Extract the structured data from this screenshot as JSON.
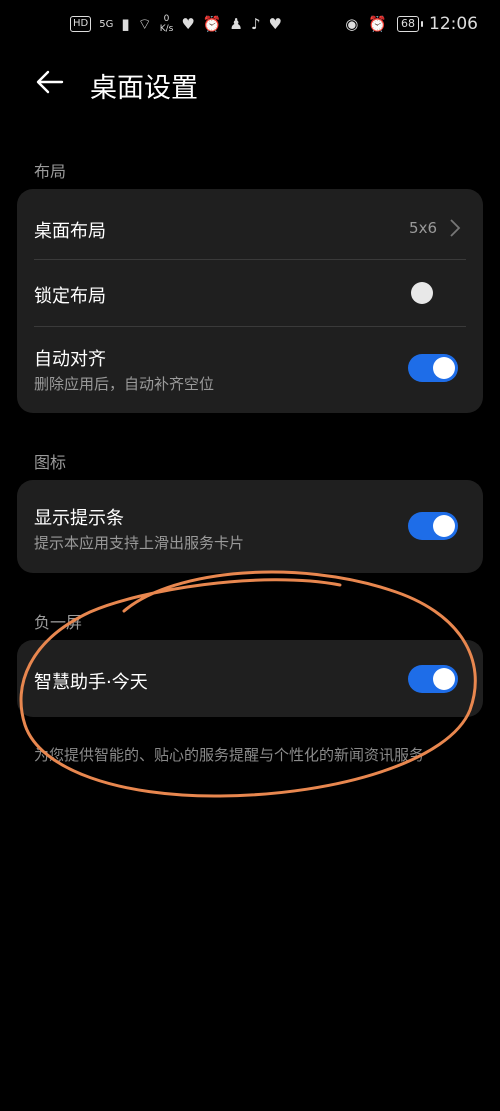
{
  "status_bar": {
    "hd": "HD",
    "signal": "5G",
    "net_speed_value": "0",
    "net_speed_unit": "K/s",
    "battery": "68",
    "time": "12:06"
  },
  "header": {
    "title": "桌面设置"
  },
  "sections": {
    "layout": {
      "label": "布局",
      "desktop_layout": {
        "title": "桌面布局",
        "value": "5x6"
      },
      "lock_layout": {
        "title": "锁定布局",
        "enabled": false
      },
      "auto_align": {
        "title": "自动对齐",
        "subtitle": "删除应用后，自动补齐空位",
        "enabled": true
      }
    },
    "icons": {
      "label": "图标",
      "show_hint_bar": {
        "title": "显示提示条",
        "subtitle": "提示本应用支持上滑出服务卡片",
        "enabled": true
      }
    },
    "minus_one": {
      "label": "负一屏",
      "assistant": {
        "title": "智慧助手·今天",
        "enabled": true
      },
      "description": "为您提供智能的、贴心的服务提醒与个性化的新闻资讯服务"
    }
  },
  "colors": {
    "accent": "#1e6de8",
    "card_bg": "#1f1f1f",
    "annotation": "#e8874f"
  }
}
